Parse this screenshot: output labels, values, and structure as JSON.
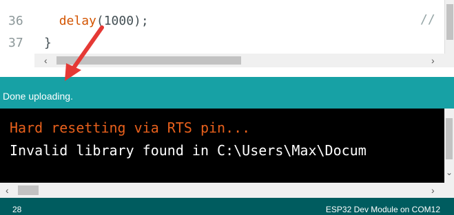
{
  "editor": {
    "lines": [
      {
        "number": "36",
        "indent": "  ",
        "func": "delay",
        "rest": "(1000);"
      },
      {
        "number": "37",
        "text": "}"
      }
    ],
    "comment_fragment": "//"
  },
  "status": {
    "message": "Done uploading."
  },
  "console": {
    "lines": [
      "Hard resetting via RTS pin...",
      "Invalid library found in C:\\Users\\Max\\Docum"
    ]
  },
  "footer": {
    "line_number": "28",
    "board_port": "ESP32 Dev Module on COM12"
  },
  "colors": {
    "status_bg": "#17a1a5",
    "footer_bg": "#005c5f",
    "console_bg": "#000000",
    "console_warning": "#e8601c",
    "arrow": "#e53935"
  },
  "icons": [
    "left-arrow-icon",
    "right-arrow-icon",
    "down-arrow-icon"
  ]
}
